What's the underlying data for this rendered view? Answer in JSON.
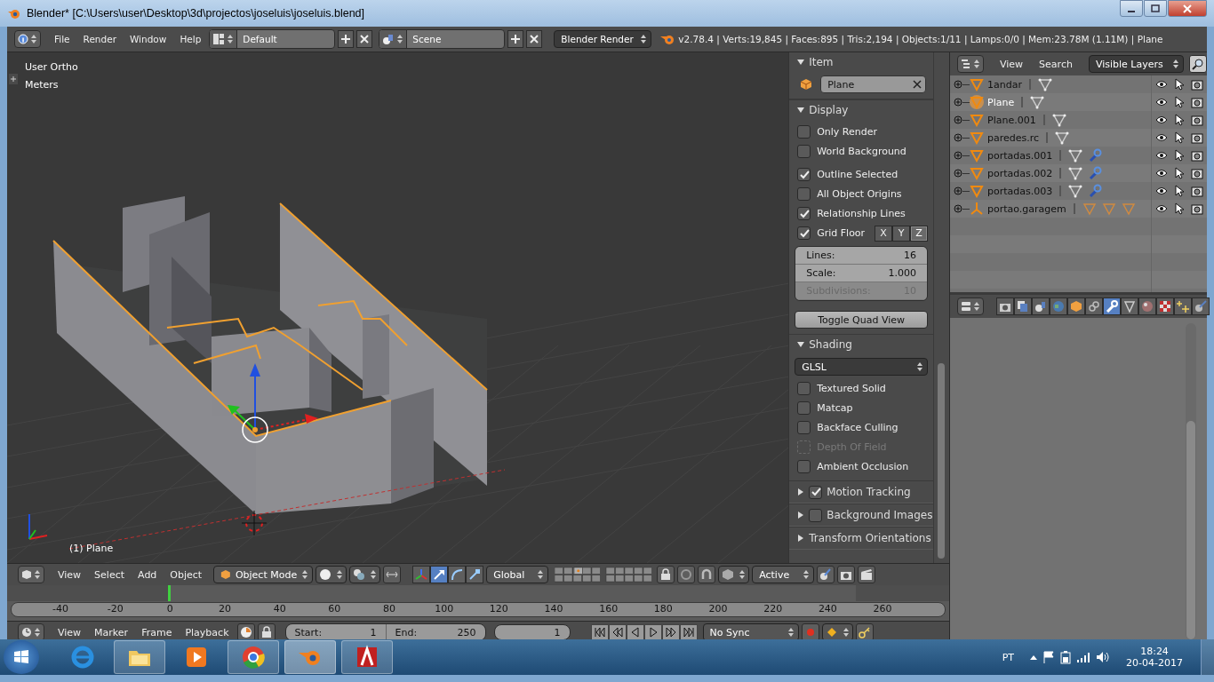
{
  "window": {
    "title": "Blender* [C:\\Users\\user\\Desktop\\3d\\projectos\\joseluis\\joseluis.blend]"
  },
  "info_header": {
    "menus": [
      "File",
      "Render",
      "Window",
      "Help"
    ],
    "screen_layout": "Default",
    "scene": "Scene",
    "render_engine": "Blender Render",
    "stats": "v2.78.4 | Verts:19,845 | Faces:895 | Tris:2,194 | Objects:1/11 | Lamps:0/0 | Mem:23.78M (1.11M) | Plane"
  },
  "viewport": {
    "view_name": "User Ortho",
    "units": "Meters",
    "object_label": "(1) Plane"
  },
  "n_panel": {
    "item": {
      "title": "Item",
      "name": "Plane"
    },
    "display": {
      "title": "Display",
      "options": [
        {
          "label": "Only Render",
          "checked": false,
          "disabled": false
        },
        {
          "label": "World Background",
          "checked": false,
          "disabled": false
        },
        {
          "label": "Outline Selected",
          "checked": true,
          "disabled": false
        },
        {
          "label": "All Object Origins",
          "checked": false,
          "disabled": false
        },
        {
          "label": "Relationship Lines",
          "checked": true,
          "disabled": false
        }
      ],
      "grid_floor": {
        "label": "Grid Floor",
        "checked": true,
        "axes": [
          {
            "label": "X",
            "selected": false
          },
          {
            "label": "Y",
            "selected": false
          },
          {
            "label": "Z",
            "selected": true
          }
        ]
      },
      "fields": [
        {
          "label": "Lines:",
          "value": "16",
          "disabled": false
        },
        {
          "label": "Scale:",
          "value": "1.000",
          "disabled": false
        },
        {
          "label": "Subdivisions:",
          "value": "10",
          "disabled": true
        }
      ],
      "button": "Toggle Quad View"
    },
    "shading": {
      "title": "Shading",
      "mode": "GLSL",
      "options": [
        {
          "label": "Textured Solid",
          "checked": false,
          "disabled": false
        },
        {
          "label": "Matcap",
          "checked": false,
          "disabled": false
        },
        {
          "label": "Backface Culling",
          "checked": false,
          "disabled": false
        },
        {
          "label": "Depth Of Field",
          "checked": false,
          "disabled": true
        },
        {
          "label": "Ambient Occlusion",
          "checked": false,
          "disabled": false
        }
      ]
    },
    "collapsed_panels": [
      {
        "title": "Motion Tracking",
        "kind": "checkbox",
        "checked": true
      },
      {
        "title": "Background Images",
        "kind": "checkbox",
        "checked": false
      },
      {
        "title": "Transform Orientations",
        "kind": "plain"
      }
    ]
  },
  "outliner": {
    "menus": [
      "View",
      "Search"
    ],
    "filter": "Visible Layers",
    "items": [
      {
        "name": "1andar",
        "kind": "mesh",
        "selected": false,
        "sub_icons": [
          {
            "kind": "mesh"
          }
        ]
      },
      {
        "name": "Plane",
        "kind": "mesh",
        "selected": true,
        "sub_icons": [
          {
            "kind": "mesh"
          }
        ]
      },
      {
        "name": "Plane.001",
        "kind": "mesh",
        "selected": false,
        "sub_icons": [
          {
            "kind": "mesh"
          }
        ]
      },
      {
        "name": "paredes.rc",
        "kind": "mesh",
        "selected": false,
        "sub_icons": [
          {
            "kind": "mesh"
          }
        ]
      },
      {
        "name": "portadas.001",
        "kind": "mesh",
        "selected": false,
        "sub_icons": [
          {
            "kind": "mesh"
          },
          {
            "kind": "wrench"
          }
        ]
      },
      {
        "name": "portadas.002",
        "kind": "mesh",
        "selected": false,
        "sub_icons": [
          {
            "kind": "mesh"
          },
          {
            "kind": "wrench"
          }
        ]
      },
      {
        "name": "portadas.003",
        "kind": "mesh",
        "selected": false,
        "sub_icons": [
          {
            "kind": "mesh"
          },
          {
            "kind": "wrench"
          }
        ]
      },
      {
        "name": "portao.garagem",
        "kind": "empty",
        "selected": false,
        "sub_icons": [
          {
            "kind": "object"
          },
          {
            "kind": "object"
          },
          {
            "kind": "object"
          }
        ]
      }
    ]
  },
  "properties_tabs": [
    {
      "kind": "render",
      "selected": false
    },
    {
      "kind": "layers",
      "selected": false
    },
    {
      "kind": "scene",
      "selected": false
    },
    {
      "kind": "world",
      "selected": false
    },
    {
      "kind": "object",
      "selected": false
    },
    {
      "kind": "constraints",
      "selected": false
    },
    {
      "kind": "modifiers",
      "selected": true
    },
    {
      "kind": "data",
      "selected": false
    },
    {
      "kind": "material",
      "selected": false
    },
    {
      "kind": "texture",
      "selected": false
    },
    {
      "kind": "particles",
      "selected": false
    },
    {
      "kind": "physics",
      "selected": false
    }
  ],
  "view3d_header": {
    "menus": [
      "View",
      "Select",
      "Add",
      "Object"
    ],
    "mode": "Object Mode",
    "manipulators": [
      {
        "kind": "axes",
        "selected": false
      },
      {
        "kind": "translate",
        "selected": true
      },
      {
        "kind": "rotate",
        "selected": false
      },
      {
        "kind": "scale",
        "selected": false
      }
    ],
    "orientation": "Global",
    "snap_target": "Active"
  },
  "timeline": {
    "ticks": [
      "-40",
      "-20",
      "0",
      "20",
      "40",
      "60",
      "80",
      "100",
      "120",
      "140",
      "160",
      "180",
      "200",
      "220",
      "240",
      "260"
    ]
  },
  "timeline_header": {
    "menus": [
      "View",
      "Marker",
      "Frame",
      "Playback"
    ],
    "start": {
      "label": "Start:",
      "value": "1"
    },
    "end": {
      "label": "End:",
      "value": "250"
    },
    "current_frame": "1",
    "sync": "No Sync"
  },
  "taskbar": {
    "apps": [
      {
        "kind": "browser",
        "open": false,
        "selected": false
      },
      {
        "kind": "folder",
        "open": true,
        "selected": false
      },
      {
        "kind": "media",
        "open": false,
        "selected": false
      },
      {
        "kind": "chrome",
        "open": true,
        "selected": false
      },
      {
        "kind": "blender",
        "open": true,
        "selected": true
      },
      {
        "kind": "cad",
        "open": true,
        "selected": false
      }
    ],
    "language": "PT",
    "time": "18:24",
    "date": "20-04-2017"
  }
}
